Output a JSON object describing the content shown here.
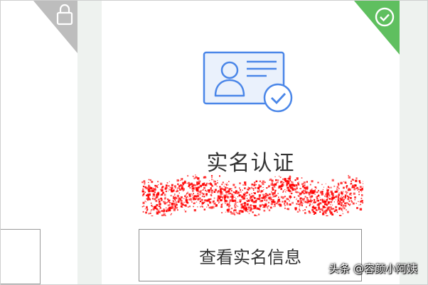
{
  "cards": {
    "left": {
      "status": "locked",
      "ribbon_color": "#bdbdbd",
      "icon": "lock-icon"
    },
    "main": {
      "status": "verified",
      "ribbon_color": "#5fbf5f",
      "badge_icon": "check-circle-icon",
      "illustration_icon": "id-card-check-icon",
      "accent_color": "#4a86e8",
      "title": "实名认证",
      "button_label": "查看实名信息",
      "redaction_color": "#ff0000"
    }
  },
  "watermark": "头条 @容颜小阿姨"
}
